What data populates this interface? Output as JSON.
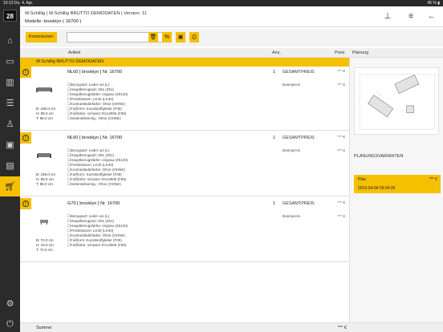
{
  "statusbar": {
    "time_date": "10:13  Do. 4. Apr.",
    "battery": "46 % ▮"
  },
  "sidebar": {
    "logo": "28"
  },
  "header": {
    "title": "W.Schillig | W.Schillig BRUTTO DEMODATEN | Version: 11",
    "subtitle": "Modelle: brooklyn ( 16700 )"
  },
  "toolbar": {
    "kommission_label": "Kommission:",
    "kommission_value": ""
  },
  "columns": {
    "artikel": "Artikel",
    "anz": "Anz.",
    "preis": "Preis",
    "planung": "Planung"
  },
  "group": {
    "title": "W.Schillig BRUTTO DEMODATEN"
  },
  "items": [
    {
      "name": "NL60 [ brooklyn ] Nr. 16700",
      "qty": "1",
      "price_label": "GESAMTPREIS",
      "price": "*** €",
      "base_label": "Basispreis",
      "base_price": "*** €",
      "dims": [
        "B: 236.0 cm",
        "H: 85.0 cm",
        "T: 96.0 cm"
      ],
      "props": [
        "☐Bezugsart: Leder uni (L)",
        "☐Hauptbezugsart: Z51 (Z51)",
        "☐Hauptbezugsfarbe: eisgrau (Z5120)",
        "☐Preisklassen: LK40 (LK40)",
        "☐Kontrastlederfarbe: Ohne (OHNE)",
        "☐Fußform: Kunststoffgleiter (F00)",
        "☐Fußfarbe: schwarz RAL9005 (F89)",
        "☐Seitenteilverstg.: Ohne (OHNE)"
      ]
    },
    {
      "name": "NL60 [ brooklyn ] Nr. 16700",
      "qty": "1",
      "price_label": "GESAMTPREIS",
      "price": "*** €",
      "base_label": "Basispreis",
      "base_price": "*** €",
      "dims": [
        "B: 196.0 cm",
        "H: 85.0 cm",
        "T: 96.0 cm"
      ],
      "props": [
        "☐Bezugsart: Leder uni (L)",
        "☐Hauptbezugsart: Z51 (Z51)",
        "☐Hauptbezugsfarbe: eisgrau (Z5120)",
        "☐Preisklassen: LK40 (LK40)",
        "☐Kontrastlederfarbe: Ohne (OHNE)",
        "☐Fußform: Kunststoffgleiter (F00)",
        "☐Fußfarbe: schwarz RAL9005 (F89)",
        "☐Seitenteilverstg.: Ohne (OHNE)"
      ]
    },
    {
      "name": "G70 [ brooklyn ] Nr. 16700",
      "qty": "1",
      "price_label": "GESAMTPREIS",
      "price": "*** €",
      "base_label": "Basispreis",
      "base_price": "*** €",
      "dims": [
        "B: 74.0 cm",
        "H: 43.0 cm",
        "T: 72.0 cm"
      ],
      "props": [
        "☐Bezugsart: Leder uni (L)",
        "☐Hauptbezugsart: Z51 (Z51)",
        "☐Hauptbezugsfarbe: eisgrau (Z5120)",
        "☐Preisklassen: LK40 (LK40)",
        "☐Kontrastlederfarbe: Ohne (OHNE)",
        "☐Fußform: Kunststoffgleiter (F00)",
        "☐Fußfarbe: schwarz RAL9005 (F89)"
      ]
    }
  ],
  "summary": {
    "label": "Summe:",
    "value": "*** €"
  },
  "planning": {
    "varianten_title": "PLANUNGSVARIANTEN",
    "variant": {
      "name": "Plan",
      "stars": "*** €",
      "date": "2019-04-04 09:34:26"
    }
  },
  "colors": {
    "accent": "#f5c000",
    "sidebar": "#2b2b2b"
  }
}
